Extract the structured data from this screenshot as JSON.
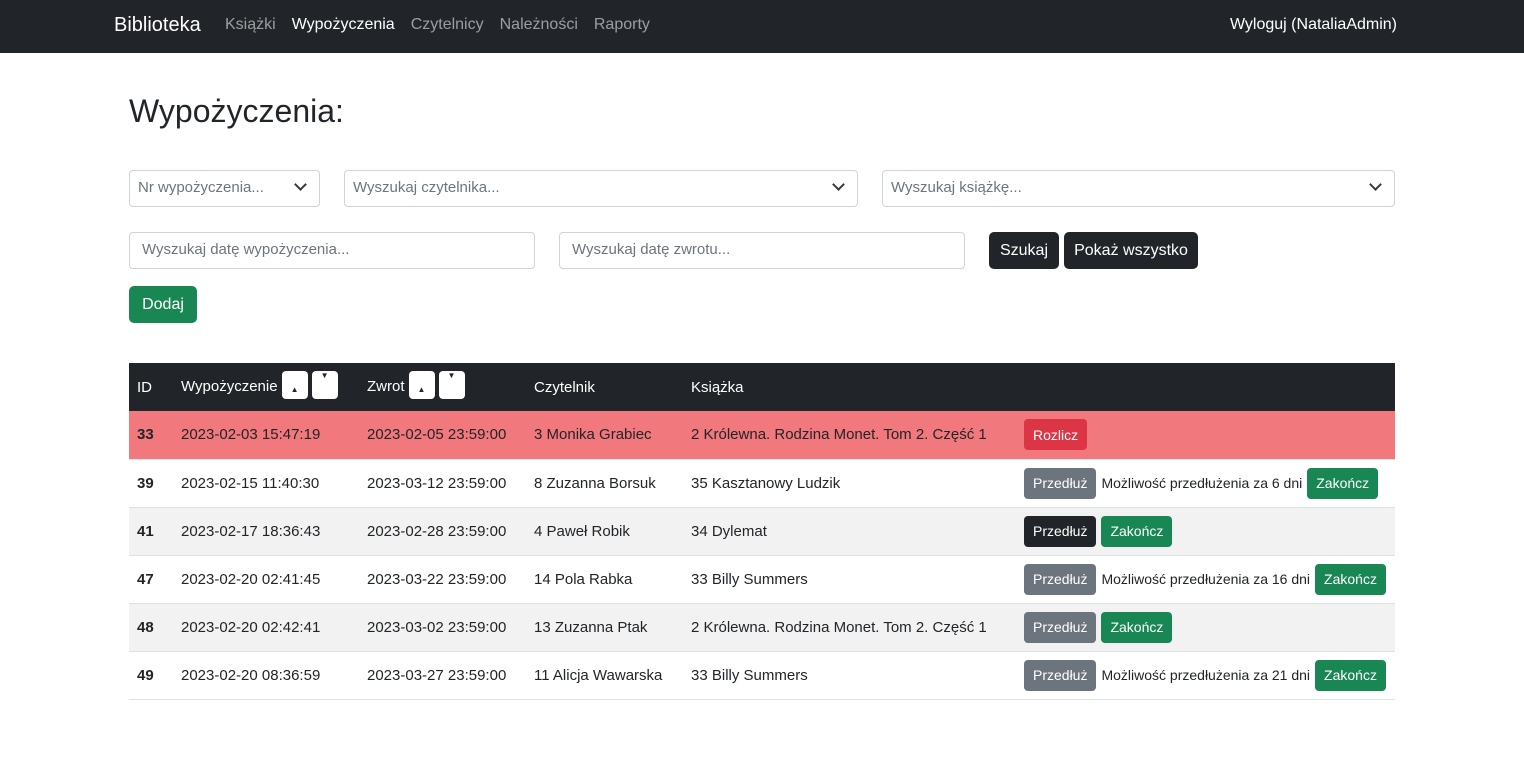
{
  "navbar": {
    "brand": "Biblioteka",
    "links": [
      "Książki",
      "Wypożyczenia",
      "Czytelnicy",
      "Należności",
      "Raporty"
    ],
    "active": "Wypożyczenia",
    "logout": "Wyloguj (NataliaAdmin)"
  },
  "page": {
    "title": "Wypożyczenia:"
  },
  "filters": {
    "loan_no_placeholder": "Nr wypożyczenia...",
    "reader_placeholder": "Wyszukaj czytelnika...",
    "book_placeholder": "Wyszukaj książkę...",
    "loan_date_placeholder": "Wyszukaj datę wypożyczenia...",
    "return_date_placeholder": "Wyszukaj datę zwrotu...",
    "search_label": "Szukaj",
    "show_all_label": "Pokaż wszystko",
    "add_label": "Dodaj"
  },
  "table": {
    "headers": {
      "id": "ID",
      "loan": "Wypożyczenie",
      "return": "Zwrot",
      "reader": "Czytelnik",
      "book": "Książka"
    },
    "rows": [
      {
        "id": "33",
        "loan": "2023-02-03 15:47:19",
        "ret": "2023-02-05 23:59:00",
        "reader": "3 Monika Grabiec",
        "book": "2 Królewna. Rodzina Monet. Tom 2. Część 1",
        "settle": "Rozlicz"
      },
      {
        "id": "39",
        "loan": "2023-02-15 11:40:30",
        "ret": "2023-03-12 23:59:00",
        "reader": "8 Zuzanna Borsuk",
        "book": "35 Kasztanowy Ludzik",
        "extend": "Przedłuż",
        "note": "Możliwość przedłużenia za 6 dni",
        "finish": "Zakończ"
      },
      {
        "id": "41",
        "loan": "2023-02-17 18:36:43",
        "ret": "2023-02-28 23:59:00",
        "reader": "4 Paweł Robik",
        "book": "34 Dylemat",
        "extend": "Przedłuż",
        "finish": "Zakończ"
      },
      {
        "id": "47",
        "loan": "2023-02-20 02:41:45",
        "ret": "2023-03-22 23:59:00",
        "reader": "14 Pola Rabka",
        "book": "33 Billy Summers",
        "extend": "Przedłuż",
        "note": "Możliwość przedłużenia za 16 dni",
        "finish": "Zakończ"
      },
      {
        "id": "48",
        "loan": "2023-02-20 02:42:41",
        "ret": "2023-03-02 23:59:00",
        "reader": "13 Zuzanna Ptak",
        "book": "2 Królewna. Rodzina Monet. Tom 2. Część 1",
        "extend": "Przedłuż",
        "finish": "Zakończ"
      },
      {
        "id": "49",
        "loan": "2023-02-20 08:36:59",
        "ret": "2023-03-27 23:59:00",
        "reader": "11 Alicja Wawarska",
        "book": "33 Billy Summers",
        "extend": "Przedłuż",
        "note": "Możliwość przedłużenia za 21 dni",
        "finish": "Zakończ"
      }
    ]
  },
  "colors": {
    "navbar": "#212529",
    "overdue_row": "#f1787c",
    "success": "#198754",
    "danger": "#dc3545",
    "secondary": "#6c757d"
  }
}
